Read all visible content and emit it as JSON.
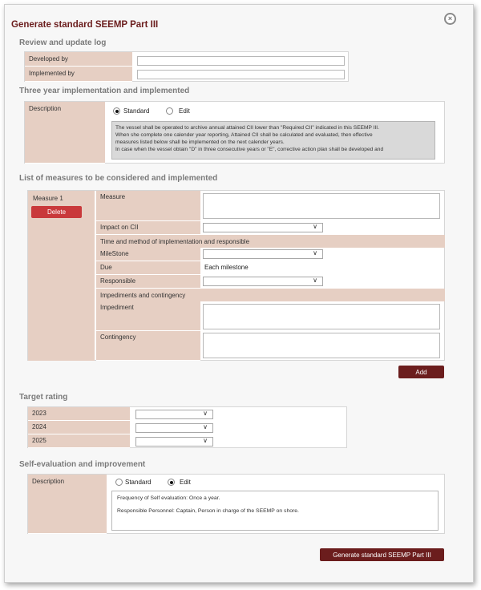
{
  "dialog": {
    "title": "Generate standard SEEMP Part III",
    "close_icon": "×"
  },
  "review_log": {
    "heading": "Review and update log",
    "rows": [
      {
        "label": "Developed by",
        "value": ""
      },
      {
        "label": "Implemented by",
        "value": ""
      }
    ]
  },
  "three_year": {
    "heading": "Three year implementation and implemented",
    "label": "Description",
    "options": [
      "Standard",
      "Edit"
    ],
    "selected": "Standard",
    "text_lines": [
      "The vessel shall be operated to archive annual attained CII lower than \"Required CII\" indicated in this SEEMP III.",
      "When she complete one calender year reporting, Attained CII shall be calculated and evaluated, then effective",
      "measures listed below shall be implemented on the next calender years.",
      "In case when the vessel obtain \"D\" in three consecutive years or \"E\", corrective action plan shall be developed and"
    ]
  },
  "measures": {
    "heading": "List of measures to be considered and implemented",
    "measure_label": "Measure 1",
    "delete_label": "Delete",
    "fields": {
      "measure": "Measure",
      "impact": "Impact on CII",
      "time_method": "Time and method of implementation and responsible",
      "milestone": "MileStone",
      "due": "Due",
      "due_value": "Each milestone",
      "responsible": "Responsible",
      "impediments_band": "Impediments and contingency",
      "impediment": "Impediment",
      "contingency": "Contingency"
    },
    "add_label": "Add"
  },
  "target_rating": {
    "heading": "Target rating",
    "years": [
      "2023",
      "2024",
      "2025"
    ]
  },
  "self_eval": {
    "heading": "Self-evaluation and improvement",
    "label": "Description",
    "options": [
      "Standard",
      "Edit"
    ],
    "selected": "Edit",
    "lines": [
      "Frequency of Self evaluation: Once a year.",
      "Responsible Personnel: Captain, Person in charge of the SEEMP on shore."
    ]
  },
  "generate_label": "Generate standard SEEMP Part III",
  "chevron": "∨"
}
